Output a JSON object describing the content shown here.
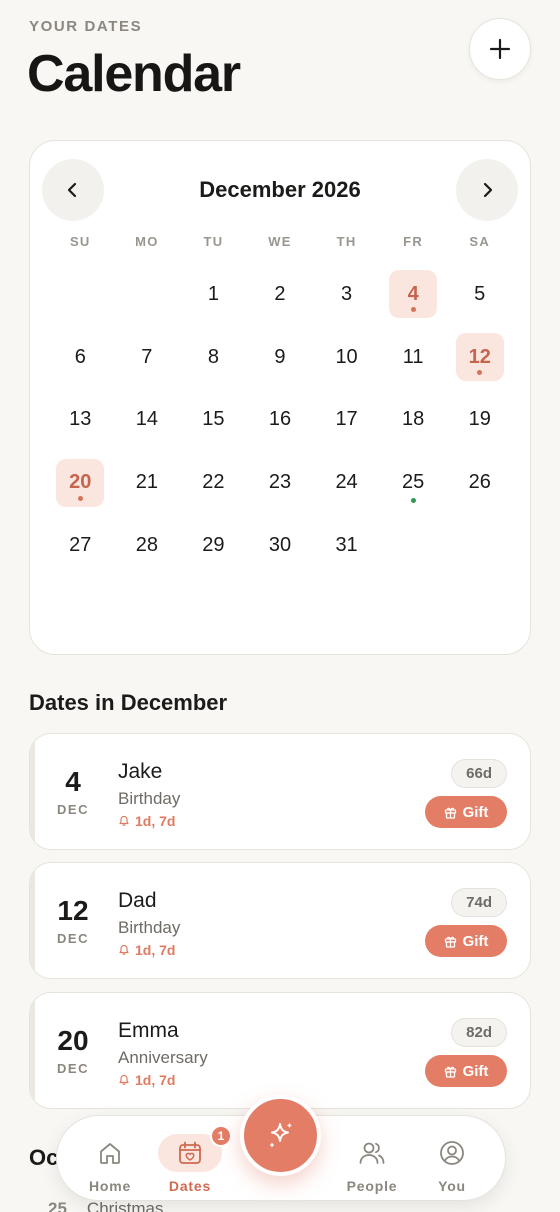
{
  "header": {
    "eyebrow": "YOUR DATES",
    "title": "Calendar"
  },
  "calendar": {
    "month_label": "December 2026",
    "weekdays": [
      "SU",
      "MO",
      "TU",
      "WE",
      "TH",
      "FR",
      "SA"
    ],
    "first_weekday_index": 2,
    "days_in_month": 31,
    "event_days": [
      4,
      12,
      20
    ],
    "dot_days_event": [
      4,
      12,
      20
    ],
    "dot_days_holiday": [
      25
    ]
  },
  "section_title": "Dates in December",
  "events": [
    {
      "day": "4",
      "month": "DEC",
      "name": "Jake",
      "type": "Birthday",
      "reminders": "1d, 7d",
      "countdown": "66d",
      "gift_label": "Gift"
    },
    {
      "day": "12",
      "month": "DEC",
      "name": "Dad",
      "type": "Birthday",
      "reminders": "1d, 7d",
      "countdown": "74d",
      "gift_label": "Gift"
    },
    {
      "day": "20",
      "month": "DEC",
      "name": "Emma",
      "type": "Anniversary",
      "reminders": "1d, 7d",
      "countdown": "82d",
      "gift_label": "Gift"
    }
  ],
  "next_section_peek": {
    "title": "Oc",
    "day": "25",
    "label": "Christmas"
  },
  "tabbar": {
    "home": "Home",
    "dates": "Dates",
    "dates_badge": "1",
    "people": "People",
    "you": "You"
  },
  "colors": {
    "accent": "#e37d66",
    "accent_soft": "#fbe6df",
    "holiday_dot": "#2d9b52",
    "background": "#f8f7f4"
  }
}
